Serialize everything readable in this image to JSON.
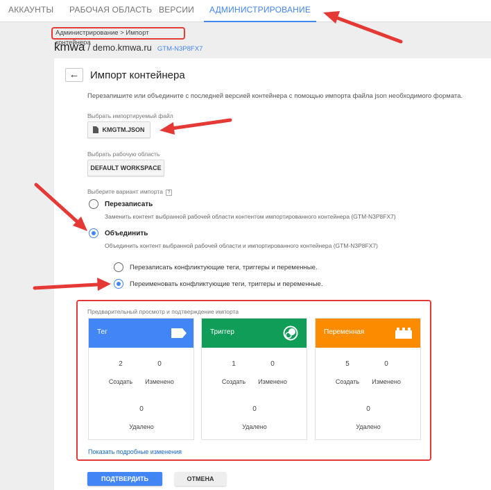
{
  "nav": {
    "tabs": [
      {
        "label": "АККАУНТЫ"
      },
      {
        "label": "РАБОЧАЯ ОБЛАСТЬ"
      },
      {
        "label": "ВЕРСИИ"
      },
      {
        "label": "АДМИНИСТРИРОВАНИЕ"
      }
    ],
    "accent": "#4285f4"
  },
  "breadcrumb": "Администрирование > Импорт контейнера",
  "container": {
    "name": "kmwa",
    "separator": "/ demo.kmwa.ru",
    "id": "GTM-N3P8FX7"
  },
  "import": {
    "back_icon": "←",
    "title": "Импорт контейнера",
    "description": "Перезапишите или объедините с последней версией контейнера с помощью импорта файла json необходимого формата.",
    "file_label": "Выбрать импортируемый файл",
    "file_button": "KMGTM.JSON",
    "workspace_label": "Выбрать рабочую область",
    "workspace_button": "DEFAULT WORKSPACE",
    "option_label": "Выберите вариант импорта",
    "help_icon": "?",
    "overwrite": {
      "label": "Перезаписать",
      "desc": "Заменить контент выбранной рабочей области контентом импортированного контейнера (GTM-N3P8FX7)",
      "selected": false
    },
    "merge": {
      "label": "Объединить",
      "desc": "Объединить контент выбранной рабочей области и импортированного контейнера (GTM-N3P8FX7)",
      "selected": true
    },
    "conflict_overwrite": {
      "label": "Перезаписать конфликтующие теги, триггеры и переменные.",
      "selected": false
    },
    "conflict_rename": {
      "label": "Переименовать конфликтующие теги, триггеры и переменные.",
      "selected": true
    }
  },
  "preview": {
    "title": "Предварительный просмотр и подтверждение импорта",
    "cards": [
      {
        "label": "Тег",
        "color": "#4285f4",
        "icon": "tag-icon",
        "created": "2",
        "changed": "0",
        "deleted": "0"
      },
      {
        "label": "Триггер",
        "color": "#0f9d58",
        "icon": "trigger-icon",
        "created": "1",
        "changed": "0",
        "deleted": "0"
      },
      {
        "label": "Переменная",
        "color": "#fb8c00",
        "icon": "variable-icon",
        "created": "5",
        "changed": "0",
        "deleted": "0"
      }
    ],
    "created_label": "Создать",
    "changed_label": "Изменено",
    "deleted_label": "Удалено",
    "details_link": "Показать подробные изменения"
  },
  "actions": {
    "confirm": "ПОДТВЕРДИТЬ",
    "cancel": "ОТМЕНА"
  },
  "annotation_color": "#e53935"
}
